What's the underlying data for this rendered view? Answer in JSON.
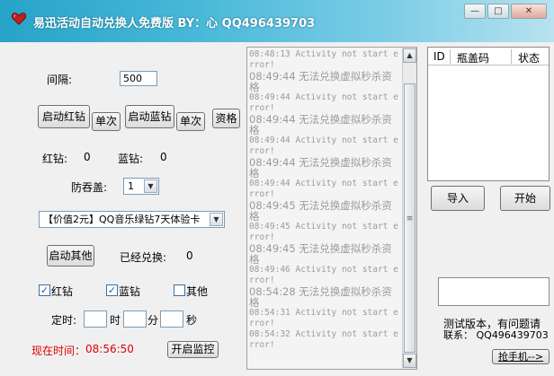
{
  "window": {
    "title": "易迅活动自动兑换人免费版 BY：心 QQ496439703",
    "minimize_glyph": "—",
    "restore_glyph": "□",
    "close_glyph": "✕"
  },
  "form": {
    "interval_label": "间隔:",
    "interval_value": "500",
    "start_red_label": "启动红钻",
    "single_red_label": "单次",
    "start_blue_label": "启动蓝钻",
    "single_blue_label": "单次",
    "qualify_label": "资格",
    "red_count_label": "红钻:",
    "red_count_value": "0",
    "blue_count_label": "蓝钻:",
    "blue_count_value": "0",
    "anti_swallow_label": "防吞盖:",
    "anti_swallow_value": "1",
    "product_select_value": "【价值2元】QQ音乐绿钻7天体验卡",
    "start_other_label": "启动其他",
    "redeemed_label": "已经兑换:",
    "redeemed_value": "0",
    "check_red_label": "红钻",
    "check_blue_label": "蓝钻",
    "check_other_label": "其他",
    "check_red_checked": true,
    "check_blue_checked": true,
    "check_other_checked": false,
    "timer_label": "定时:",
    "hour_label": "时",
    "minute_label": "分",
    "second_label": "秒",
    "current_time_label": "现在时间：",
    "current_time_value": "08:56:50",
    "monitor_label": "开启监控",
    "time_color": "#e00000"
  },
  "log": {
    "lines": [
      {
        "t": "08:48:13 Activity not start error!",
        "cn": false
      },
      {
        "t": "08:49:44 无法兑换虚拟秒杀资格",
        "cn": true
      },
      {
        "t": "08:49:44 Activity not start error!",
        "cn": false
      },
      {
        "t": "08:49:44 无法兑换虚拟秒杀资格",
        "cn": true
      },
      {
        "t": "08:49:44 Activity not start error!",
        "cn": false
      },
      {
        "t": "08:49:44 无法兑换虚拟秒杀资格",
        "cn": true
      },
      {
        "t": "08:49:44 Activity not start error!",
        "cn": false
      },
      {
        "t": "08:49:45 无法兑换虚拟秒杀资格",
        "cn": true
      },
      {
        "t": "08:49:45 Activity not start error!",
        "cn": false
      },
      {
        "t": "08:49:45 无法兑换虚拟秒杀资格",
        "cn": true
      },
      {
        "t": "08:49:46 Activity not start error!",
        "cn": false
      },
      {
        "t": "08:54:28 无法兑换虚拟秒杀资格",
        "cn": true
      },
      {
        "t": "08:54:31 Activity not start error!",
        "cn": false
      },
      {
        "t": "08:54:32 Activity not start error!",
        "cn": false
      }
    ],
    "scroll_up_glyph": "▲",
    "scroll_down_glyph": "▼",
    "thumb_glyph": "≡"
  },
  "right": {
    "col_id": "ID",
    "col_code": "瓶盖码",
    "col_status": "状态",
    "import_label": "导入",
    "start_label": "开始",
    "notice_line1": "测试版本，有问题请",
    "notice_line2": "联系： QQ496439703",
    "phone_button_label": "抢手机-->"
  },
  "icons": {
    "app_logo": "heart-logo-icon",
    "select_arrow": "chevron-down-icon"
  }
}
